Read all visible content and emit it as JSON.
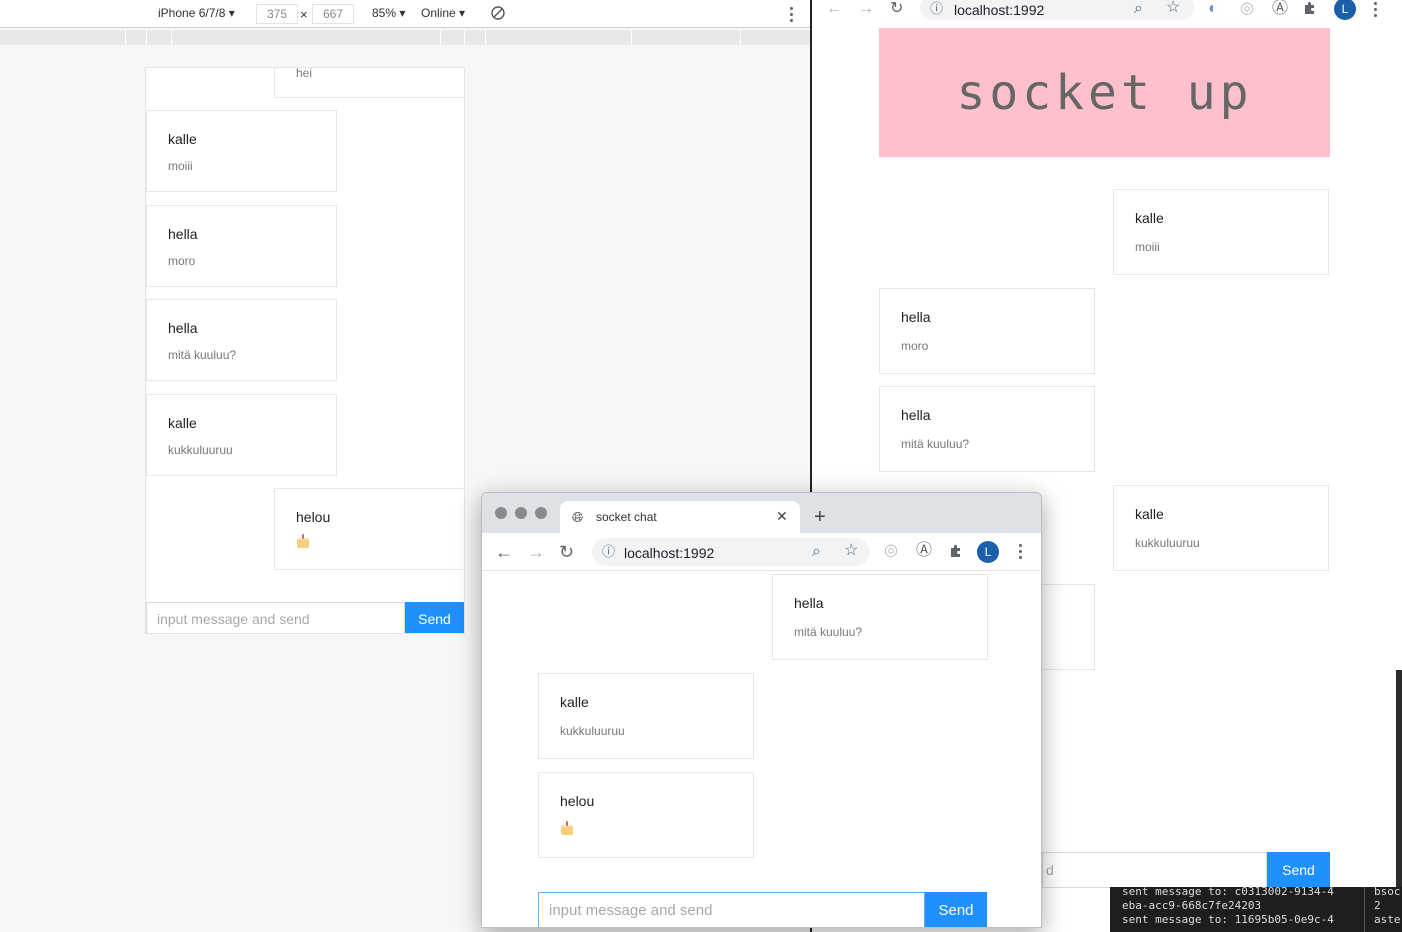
{
  "devtools": {
    "device": "iPhone 6/7/8",
    "width": "375",
    "height": "667",
    "times": "×",
    "zoom": "85%",
    "network": "Online"
  },
  "left_chat": {
    "messages": [
      {
        "name": "",
        "text": "hei"
      },
      {
        "name": "kalle",
        "text": "moiii"
      },
      {
        "name": "hella",
        "text": "moro"
      },
      {
        "name": "hella",
        "text": "mitä kuuluu?"
      },
      {
        "name": "kalle",
        "text": "kukkuluuruu"
      },
      {
        "name": "helou",
        "text": ""
      }
    ],
    "input_placeholder": "input message and send",
    "send_label": "Send"
  },
  "right_window": {
    "url": "localhost:1992",
    "banner": "socket up",
    "avatar_letter": "L",
    "messages": [
      {
        "name": "kalle",
        "text": "moiii"
      },
      {
        "name": "hella",
        "text": "moro"
      },
      {
        "name": "hella",
        "text": "mitä kuuluu?"
      },
      {
        "name": "kalle",
        "text": "kukkuluuruu"
      }
    ],
    "input_partial": "d",
    "send_label": "Send"
  },
  "terminal": {
    "lines": [
      "sent message to:  c0313002-9134-4",
      "eba-acc9-668c7fe24203",
      "sent message to:  11695b05-0e9c-4"
    ],
    "right_col": [
      "bsoc",
      "   2",
      "aste"
    ]
  },
  "front_window": {
    "tab_title": "socket chat",
    "url": "localhost:1992",
    "avatar_letter": "L",
    "messages": [
      {
        "name": "hella",
        "text": "mitä kuuluu?"
      },
      {
        "name": "kalle",
        "text": "kukkuluuruu"
      },
      {
        "name": "helou",
        "text": ""
      }
    ],
    "input_placeholder": "input message and send",
    "send_label": "Send"
  },
  "icons": {
    "back": "back-arrow-icon",
    "forward": "forward-arrow-icon",
    "reload": "reload-icon",
    "info": "info-icon",
    "zoom": "zoom-icon",
    "star": "bookmark-star-icon",
    "extensions": "puzzle-icon",
    "menu": "kebab-menu-icon",
    "cake": "birthday-cake-emoji-icon",
    "globe": "globe-icon"
  },
  "colors": {
    "send_blue": "#1e90ff",
    "banner_pink": "#fec0cb",
    "avatar_blue": "#1a5fa8"
  }
}
